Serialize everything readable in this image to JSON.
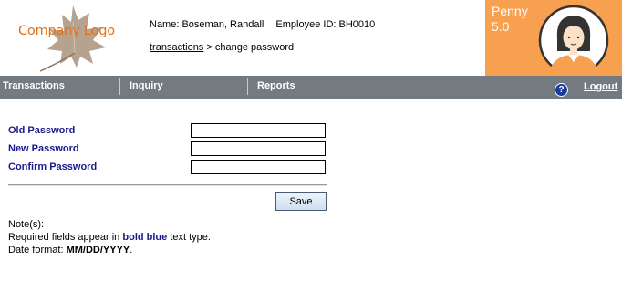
{
  "header": {
    "logo_text": "Company Logo",
    "name_label": "Name:",
    "name_value": "Boseman, Randall",
    "employee_label": "Employee ID:",
    "employee_value": "BH0010",
    "breadcrumb_link": "transactions",
    "breadcrumb_separator": ">",
    "breadcrumb_current": "change password"
  },
  "brand": {
    "name": "Penny",
    "version": "5.0",
    "color": "#f7a04f"
  },
  "nav": {
    "items": [
      "Transactions",
      "Inquiry",
      "Reports"
    ],
    "help_icon": "question-circle-icon",
    "help_symbol": "?",
    "logout_label": "Logout",
    "color": "#737a80"
  },
  "form": {
    "old_password_label": "Old Password",
    "new_password_label": "New Password",
    "confirm_password_label": "Confirm Password",
    "old_password_value": "",
    "new_password_value": "",
    "confirm_password_value": "",
    "save_label": "Save",
    "label_color": "#1a1a8c"
  },
  "notes": {
    "heading": "Note(s):",
    "required_prefix": "Required fields appear in",
    "required_emphasis": "bold blue",
    "required_suffix": "text type.",
    "date_prefix": "Date format:",
    "date_format": "MM/DD/YYYY",
    "date_suffix": "."
  }
}
